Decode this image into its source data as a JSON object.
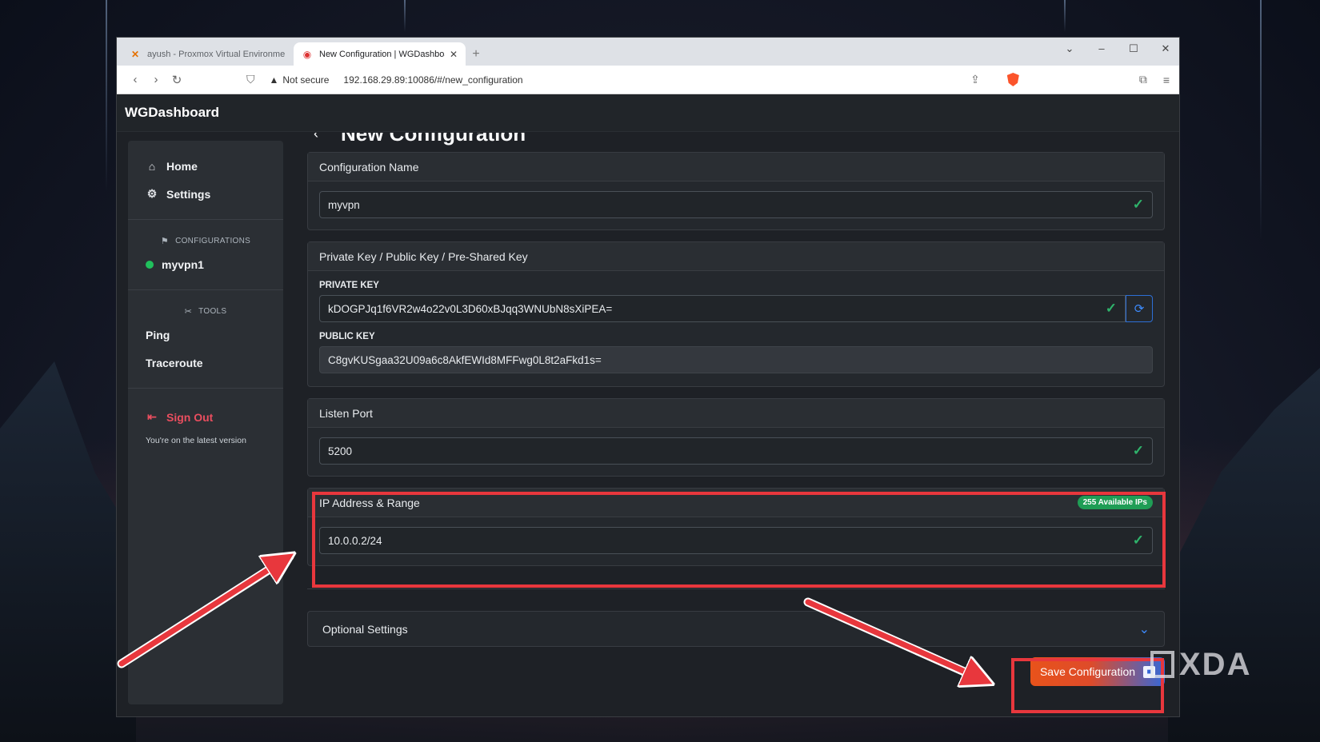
{
  "browser": {
    "tabs": [
      {
        "title": "ayush - Proxmox Virtual Environment",
        "active": false
      },
      {
        "title": "New Configuration | WGDashboard",
        "active": true
      }
    ],
    "security_label": "Not secure",
    "url": "192.168.29.89:10086/#/new_configuration"
  },
  "app": {
    "brand": "WGDashboard",
    "sidebar": {
      "home": "Home",
      "settings": "Settings",
      "configurations_heading": "CONFIGURATIONS",
      "config_item": "myvpn1",
      "tools_heading": "TOOLS",
      "ping": "Ping",
      "traceroute": "Traceroute",
      "sign_out": "Sign Out",
      "version": "You're on the latest version"
    },
    "page_title": "New Configuration",
    "config_name": {
      "label": "Configuration Name",
      "value": "myvpn"
    },
    "keys": {
      "label": "Private Key / Public Key / Pre-Shared Key",
      "private_label": "PRIVATE KEY",
      "private_value": "kDOGPJq1f6VR2w4o22v0L3D60xBJqq3WNUbN8sXiPEA=",
      "public_label": "PUBLIC KEY",
      "public_value": "C8gvKUSgaa32U09a6c8AkfEWId8MFFwg0L8t2aFkd1s="
    },
    "listen_port": {
      "label": "Listen Port",
      "value": "5200"
    },
    "ip_range": {
      "label": "IP Address & Range",
      "badge": "255 Available IPs",
      "value": "10.0.0.2/24"
    },
    "optional": {
      "label": "Optional Settings"
    },
    "save_button": "Save Configuration"
  },
  "annotation": {
    "color": "#e8373d"
  },
  "watermark": "XDA"
}
